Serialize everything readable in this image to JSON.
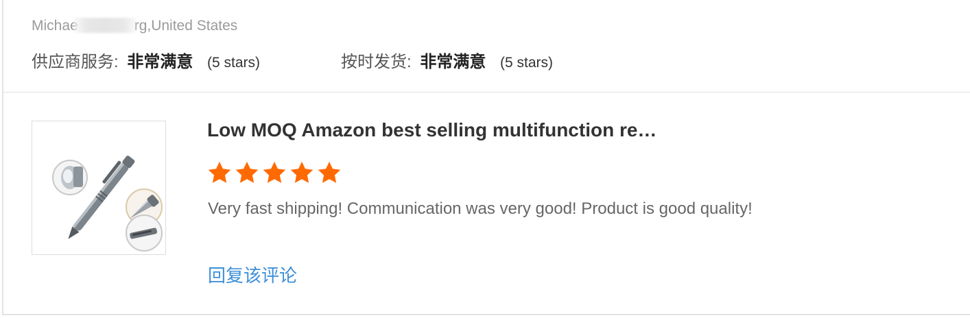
{
  "reviewer": {
    "name_visible_start": "Michae",
    "name_visible_end": "rg,United States"
  },
  "ratings": [
    {
      "label": "供应商服务:",
      "value": "非常满意",
      "stars_text": "(5 stars)"
    },
    {
      "label": "按时发货:",
      "value": "非常满意",
      "stars_text": "(5 stars)"
    }
  ],
  "product": {
    "title": "Low MOQ Amazon best selling multifunction re…",
    "image_icon": "tactical-pen-product-image",
    "rating": 5,
    "rating_max": 5,
    "star_color": "#ff6a00"
  },
  "review": {
    "text": "Very fast shipping! Communication was very good! Product is good quality!"
  },
  "actions": {
    "reply_label": "回复该评论",
    "reply_color": "#3d8fd8"
  }
}
